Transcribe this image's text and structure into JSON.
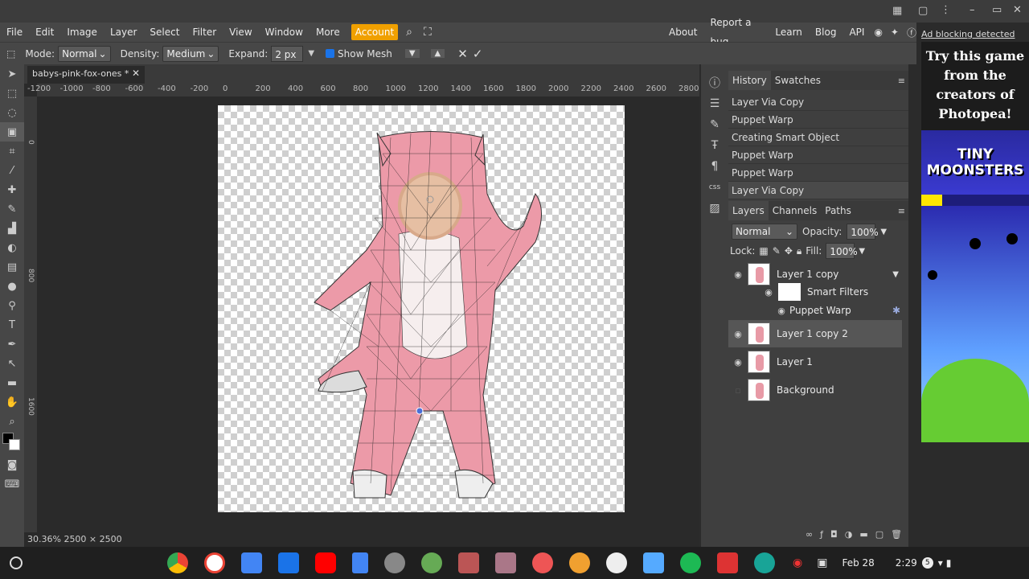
{
  "menu": {
    "items": [
      "File",
      "Edit",
      "Image",
      "Layer",
      "Select",
      "Filter",
      "View",
      "Window",
      "More"
    ],
    "account": "Account",
    "right": [
      "About",
      "Report a bug",
      "Learn",
      "Blog",
      "API"
    ]
  },
  "options": {
    "mode_label": "Mode:",
    "mode_value": "Normal",
    "density_label": "Density:",
    "density_value": "Medium",
    "expand_label": "Expand:",
    "expand_value": "2 px",
    "show_mesh_label": "Show Mesh"
  },
  "document": {
    "tab_title": "babys-pink-fox-ones",
    "tab_modified": "*",
    "status": "30.36%  2500 × 2500",
    "ruler_h": [
      "-1200",
      "-1000",
      "-800",
      "-600",
      "-400",
      "-200",
      "0",
      "200",
      "400",
      "600",
      "800",
      "1000",
      "1200",
      "1400",
      "1600",
      "1800",
      "2000",
      "2200",
      "2400",
      "2600",
      "2800"
    ]
  },
  "history": {
    "tabs": [
      "History",
      "Swatches"
    ],
    "items": [
      "Layer Via Copy",
      "Puppet Warp",
      "Creating Smart Object",
      "Puppet Warp",
      "Puppet Warp",
      "Layer Via Copy"
    ]
  },
  "layers": {
    "tabs": [
      "Layers",
      "Channels",
      "Paths"
    ],
    "blend": "Normal",
    "opacity_label": "Opacity:",
    "opacity": "100%",
    "lock_label": "Lock:",
    "fill_label": "Fill:",
    "fill": "100%",
    "list": [
      {
        "name": "Layer 1 copy"
      },
      {
        "name": "Smart Filters"
      },
      {
        "name": "Puppet Warp"
      },
      {
        "name": "Layer 1 copy 2"
      },
      {
        "name": "Layer 1"
      },
      {
        "name": "Background"
      }
    ]
  },
  "ad": {
    "blocked": "Ad blocking detected",
    "headline": "Try this game from the creators of Photopea!",
    "game": "TINY MOONSTERS"
  },
  "taskbar": {
    "date": "Feb 28",
    "time": "2:29",
    "badge": "5"
  }
}
